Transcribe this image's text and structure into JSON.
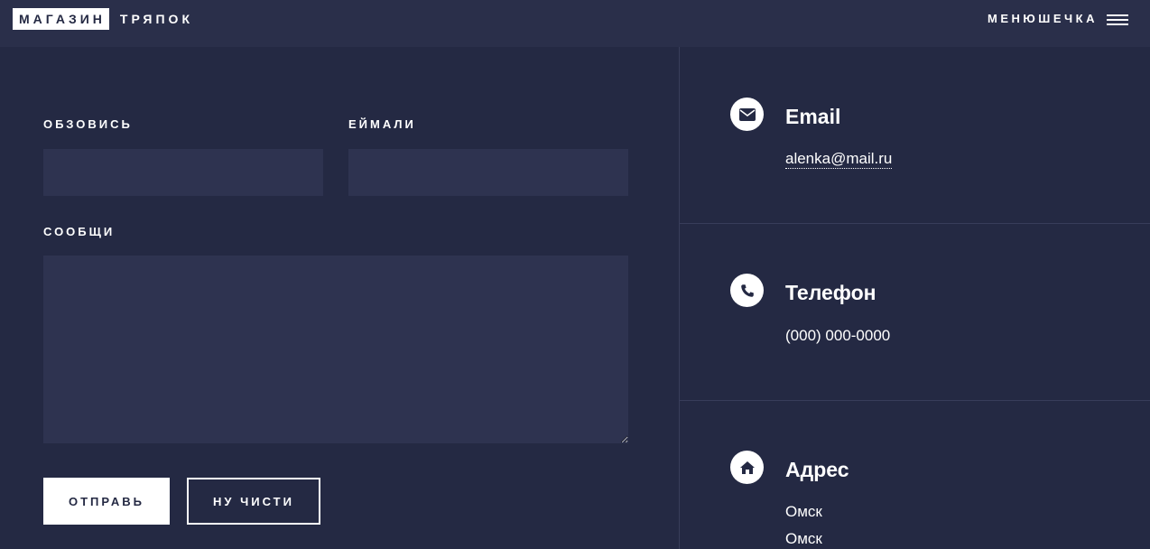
{
  "header": {
    "logo_boxed": "МАГАЗИН",
    "logo_plain": "ТРЯПОК",
    "menu_label": "МЕНЮШЕЧКА",
    "menu_icon": "hamburger-icon"
  },
  "form": {
    "name_label": "ОБЗОВИСЬ",
    "name_value": "",
    "email_label": "ЕЙМАЛИ",
    "email_value": "",
    "message_label": "СООБЩИ",
    "message_value": "",
    "submit_label": "ОТПРАВЬ",
    "reset_label": "НУ ЧИСТИ"
  },
  "contacts": [
    {
      "icon": "envelope-icon",
      "title": "Email",
      "values": [
        "alenka@mail.ru"
      ]
    },
    {
      "icon": "phone-icon",
      "title": "Телефон",
      "values": [
        "(000) 000-0000"
      ]
    },
    {
      "icon": "home-icon",
      "title": "Адрес",
      "values": [
        "Омск",
        "Омск"
      ]
    }
  ],
  "colors": {
    "background": "#242943",
    "header": "#2a2f4a",
    "input": "#2e3350",
    "text": "#ffffff"
  }
}
